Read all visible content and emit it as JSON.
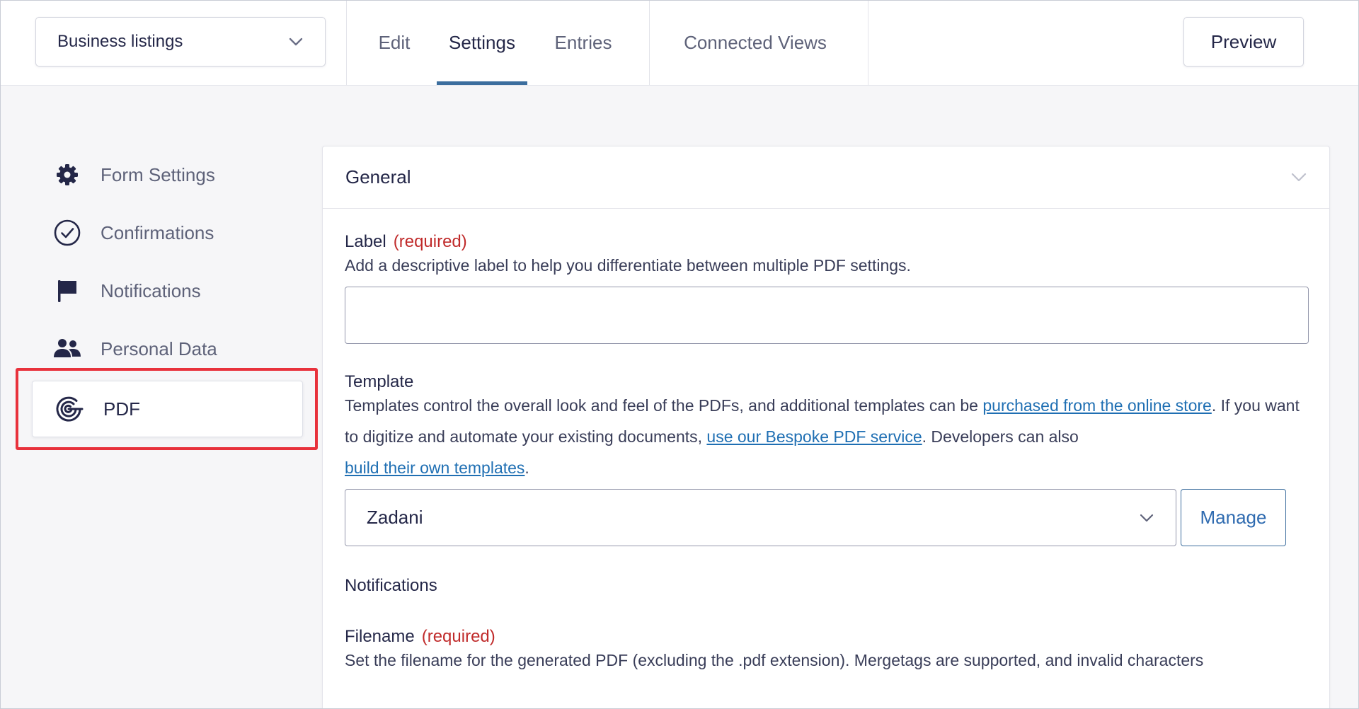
{
  "form_switcher": {
    "selected": "Business listings",
    "icon": "chevron-down-icon"
  },
  "tabs": [
    {
      "label": "Edit",
      "active": false
    },
    {
      "label": "Settings",
      "active": true
    },
    {
      "label": "Entries",
      "active": false
    },
    {
      "label": "Connected Views",
      "active": false
    }
  ],
  "preview_label": "Preview",
  "sidebar": {
    "items": [
      {
        "label": "Form Settings",
        "icon": "gear-icon"
      },
      {
        "label": "Confirmations",
        "icon": "check-circle-icon"
      },
      {
        "label": "Notifications",
        "icon": "flag-icon"
      },
      {
        "label": "Personal Data",
        "icon": "users-icon"
      },
      {
        "label": "PDF",
        "icon": "pdf-logo-icon",
        "active": true
      }
    ]
  },
  "panel": {
    "title": "General",
    "label_field": {
      "label": "Label",
      "required": "(required)",
      "description": "Add a descriptive label to help you differentiate between multiple PDF settings.",
      "value": ""
    },
    "template_field": {
      "label": "Template",
      "desc_part1": "Templates control the overall look and feel of the PDFs, and additional templates can be ",
      "link1": "purchased from the online store",
      "desc_part2": ". If you want to digitize and automate your existing documents, ",
      "link2": "use our Bespoke PDF service",
      "desc_part3": ". Developers can also ",
      "link3": "build their own templates",
      "desc_part4": ".",
      "selected": "Zadani",
      "manage_label": "Manage"
    },
    "notifications_label": "Notifications",
    "filename_field": {
      "label": "Filename",
      "required": "(required)",
      "description": "Set the filename for the generated PDF (excluding the .pdf extension). Mergetags are supported, and invalid characters"
    }
  },
  "colors": {
    "accent": "#3c6e9e",
    "link": "#1f6fb3",
    "required": "#c02b2b",
    "highlight_box": "#e8323c"
  }
}
